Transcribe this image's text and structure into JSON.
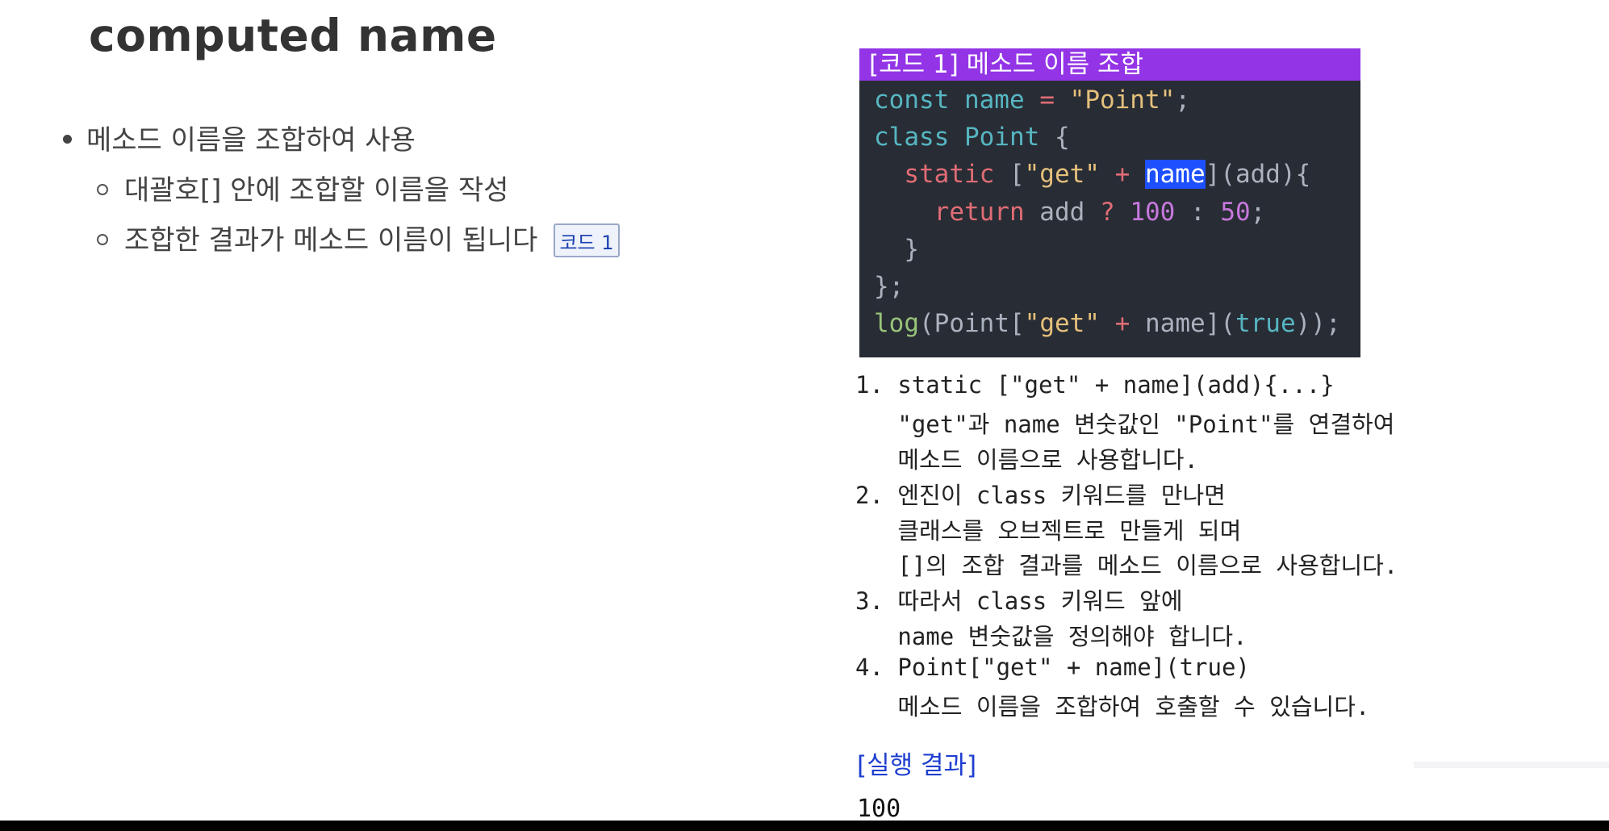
{
  "page": {
    "title": "computed name"
  },
  "bullets": {
    "main": "메소드 이름을 조합하여 사용",
    "sub1": "대괄호[] 안에 조합할 이름을 작성",
    "sub2": "조합한 결과가 메소드 이름이 됩니다",
    "ref_badge": "코드 1"
  },
  "code": {
    "header": "[코드 1] 메소드 이름 조합",
    "lines": [
      "const name = \"Point\";",
      "class Point {",
      "  static [\"get\" + name](add){",
      "    return add ? 100 : 50;",
      "  }",
      "};",
      "log(Point[\"get\" + name](true));"
    ],
    "selected_token": "name"
  },
  "notes": {
    "lines": [
      "1. static [\"get\" + name](add){...}",
      "   \"get\"과 name 변숫값인 \"Point\"를 연결하여",
      "   메소드 이름으로 사용합니다.",
      "2. 엔진이 class 키워드를 만나면",
      "   클래스를 오브젝트로 만들게 되며",
      "   []의 조합 결과를 메소드 이름으로 사용합니다.",
      "3. 따라서 class 키워드 앞에",
      "   name 변숫값을 정의해야 합니다.",
      "4. Point[\"get\" + name](true)",
      "   메소드 이름을 조합하여 호출할 수 있습니다."
    ]
  },
  "result": {
    "label": "[실행 결과]",
    "value": "100"
  },
  "colors": {
    "code_header_bg": "#9334e6",
    "code_bg": "#282c34",
    "result_label": "#1f3fd0",
    "selection": "#1e50ff"
  }
}
